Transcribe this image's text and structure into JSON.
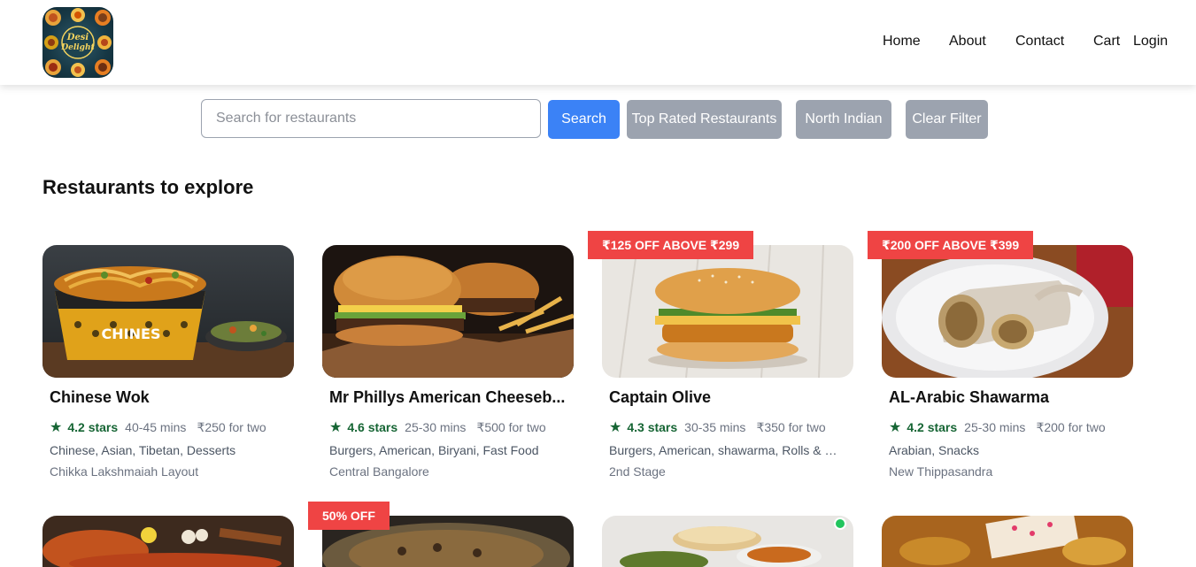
{
  "brand": {
    "logo_line1": "Desi",
    "logo_line2": "Delight"
  },
  "nav": {
    "home": "Home",
    "about": "About",
    "contact": "Contact",
    "cart": "Cart",
    "login": "Login"
  },
  "search": {
    "placeholder": "Search for restaurants",
    "value": "",
    "search_label": "Search",
    "top_rated_label": "Top Rated Restaurants",
    "north_indian_label": "North Indian",
    "clear_label": "Clear Filter"
  },
  "section_title": "Restaurants to explore",
  "colors": {
    "accent": "#3b82f6",
    "offer": "#ef4444",
    "rating": "#166534",
    "filter_button": "#9ca3af"
  },
  "restaurants": [
    {
      "name": "Chinese Wok",
      "rating": "4.2 stars",
      "eta": "40-45 mins",
      "cost": "₹250 for two",
      "cuisines": "Chinese, Asian, Tibetan, Desserts",
      "area": "Chikka Lakshmaiah Layout",
      "offer": ""
    },
    {
      "name": "Mr Phillys American Cheeseb...",
      "rating": "4.6 stars",
      "eta": "25-30 mins",
      "cost": "₹500 for two",
      "cuisines": "Burgers, American, Biryani, Fast Food",
      "area": "Central Bangalore",
      "offer": ""
    },
    {
      "name": "Captain Olive",
      "rating": "4.3 stars",
      "eta": "30-35 mins",
      "cost": "₹350 for two",
      "cuisines": "Burgers, American, shawarma, Rolls & Wr...",
      "area": "2nd Stage",
      "offer": "₹125 OFF ABOVE ₹299"
    },
    {
      "name": "AL-Arabic Shawarma",
      "rating": "4.2 stars",
      "eta": "25-30 mins",
      "cost": "₹200 for two",
      "cuisines": "Arabian, Snacks",
      "area": "New Thippasandra",
      "offer": "₹200 OFF ABOVE ₹399"
    }
  ],
  "second_row_offer": "50% OFF"
}
